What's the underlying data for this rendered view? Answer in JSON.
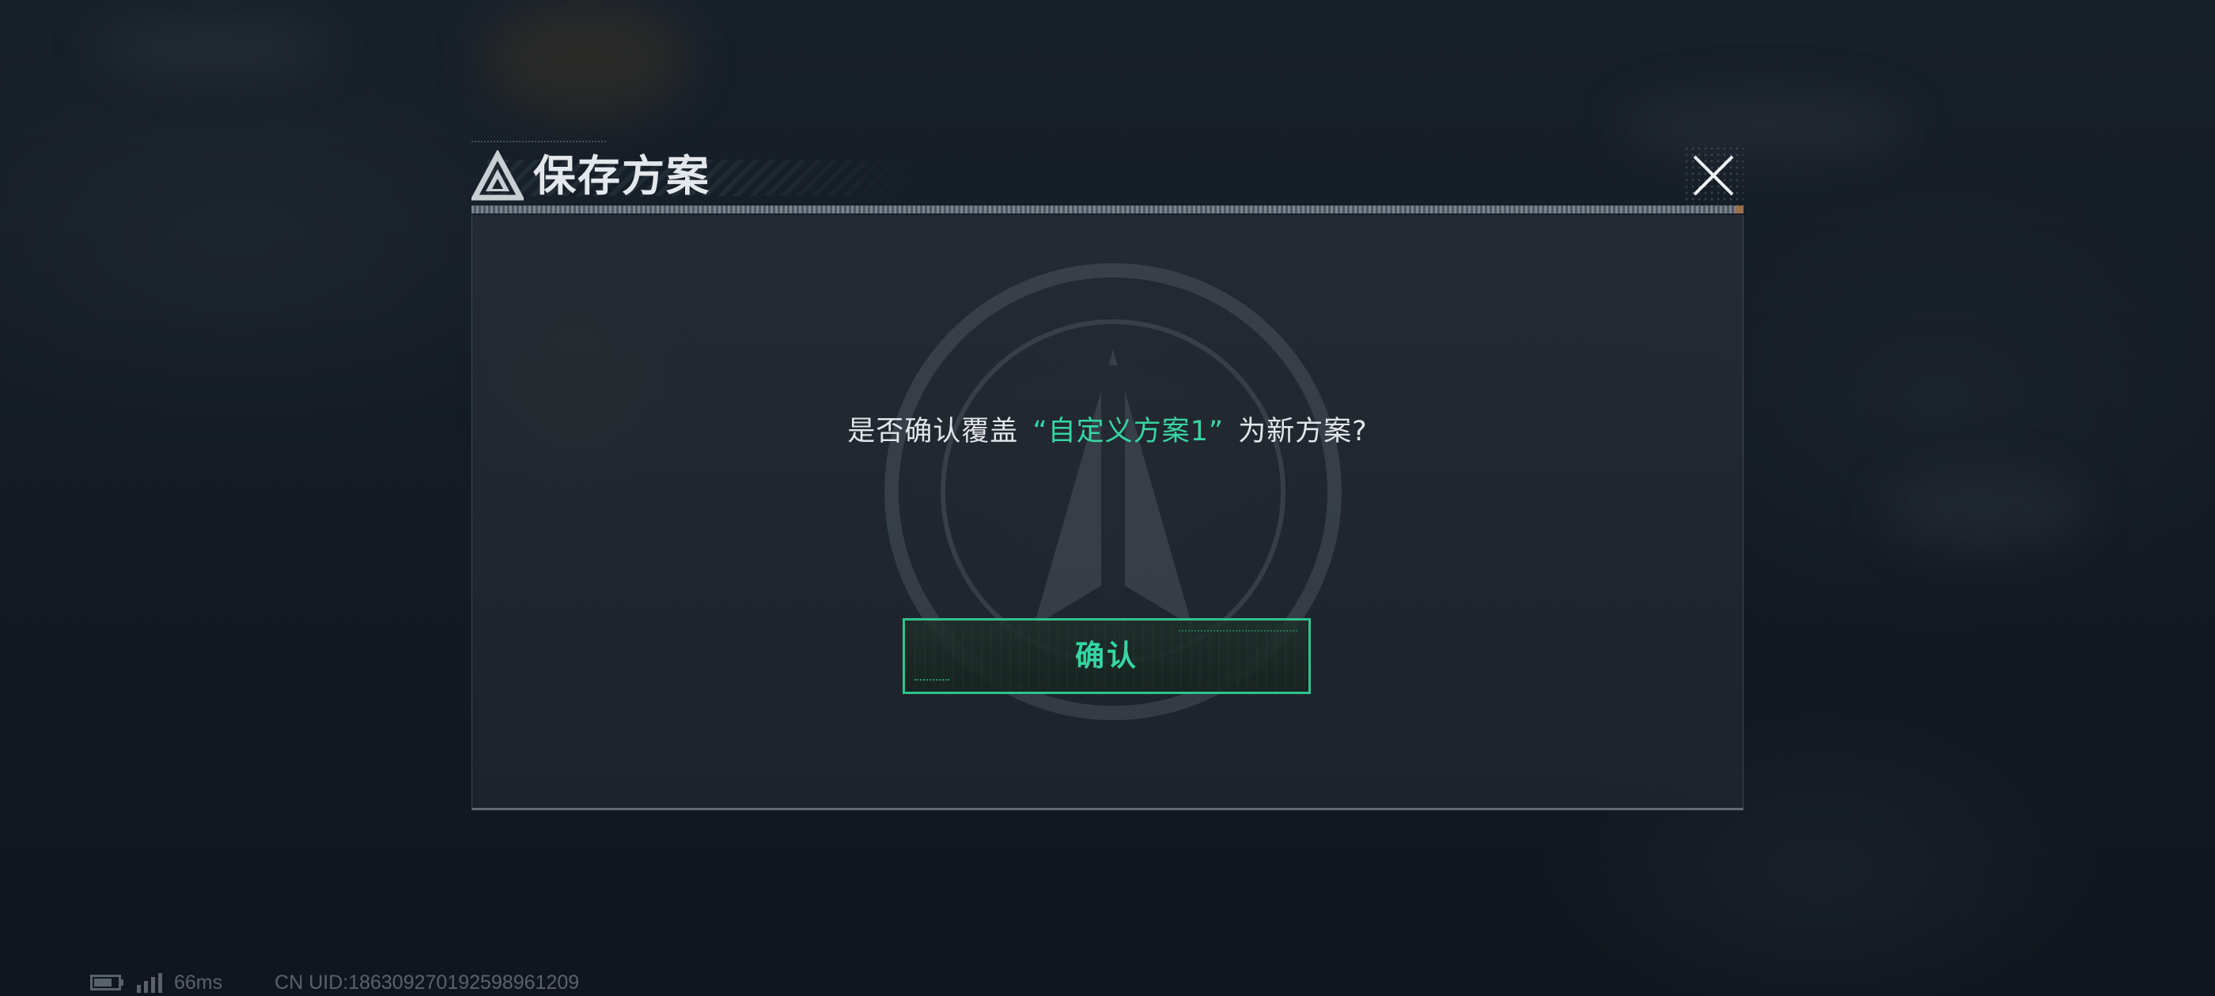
{
  "dialog": {
    "title": "保存方案",
    "message_before": "是否确认覆盖",
    "message_highlight": "“自定义方案1”",
    "message_after": "为新方案?",
    "confirm_label": "确认"
  },
  "status_bar": {
    "latency": "66ms",
    "uid": "CN UID:1863092701925989612​09"
  },
  "colors": {
    "accent": "#36d6a2",
    "title_text": "#e4e8ec",
    "message_text": "#e2e6ea",
    "status_text": "#59626c"
  },
  "icons": {
    "title_logo": "triangle-logo-icon",
    "close": "close-icon",
    "battery": "battery-icon",
    "signal": "signal-icon"
  }
}
